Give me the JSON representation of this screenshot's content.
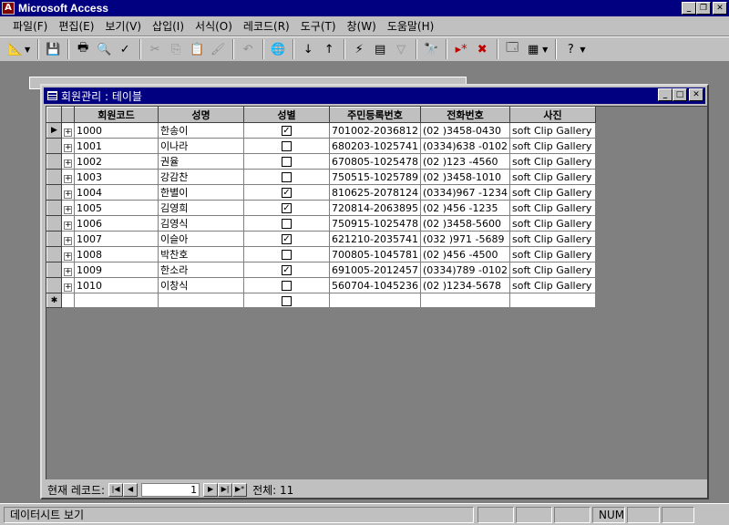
{
  "app": {
    "title": "Microsoft Access"
  },
  "menu": [
    "파일(F)",
    "편집(E)",
    "보기(V)",
    "삽입(I)",
    "서식(O)",
    "레코드(R)",
    "도구(T)",
    "창(W)",
    "도움말(H)"
  ],
  "toolbar": {
    "icons": [
      "design-view-icon",
      "save-icon",
      "print-icon",
      "print-preview-icon",
      "spelling-icon",
      "cut-icon",
      "copy-icon",
      "paste-icon",
      "format-painter-icon",
      "undo-icon",
      "hyperlink-icon",
      "sort-ascending-icon",
      "sort-descending-icon",
      "filter-by-selection-icon",
      "filter-by-form-icon",
      "apply-filter-icon",
      "find-icon",
      "new-record-icon",
      "delete-record-icon",
      "database-window-icon",
      "new-object-icon",
      "help-icon"
    ]
  },
  "datasheet": {
    "title": "회원관리 : 테이블",
    "columns": [
      "회원코드",
      "성명",
      "성별",
      "주민등록번호",
      "전화번호",
      "사진"
    ],
    "rows": [
      {
        "id": "1000",
        "name": "한송이",
        "gender": true,
        "jumin": "701002-2036812",
        "phone": "(02  )3458-0430",
        "photo": "soft Clip Gallery"
      },
      {
        "id": "1001",
        "name": "이나라",
        "gender": false,
        "jumin": "680203-1025741",
        "phone": "(0334)638  -0102",
        "photo": "soft Clip Gallery"
      },
      {
        "id": "1002",
        "name": "권율",
        "gender": false,
        "jumin": "670805-1025478",
        "phone": "(02  )123  -4560",
        "photo": "soft Clip Gallery"
      },
      {
        "id": "1003",
        "name": "강감찬",
        "gender": false,
        "jumin": "750515-1025789",
        "phone": "(02  )3458-1010",
        "photo": "soft Clip Gallery"
      },
      {
        "id": "1004",
        "name": "한별이",
        "gender": true,
        "jumin": "810625-2078124",
        "phone": "(0334)967  -1234",
        "photo": "soft Clip Gallery"
      },
      {
        "id": "1005",
        "name": "김영희",
        "gender": true,
        "jumin": "720814-2063895",
        "phone": "(02  )456  -1235",
        "photo": "soft Clip Gallery"
      },
      {
        "id": "1006",
        "name": "김영식",
        "gender": false,
        "jumin": "750915-1025478",
        "phone": "(02  )3458-5600",
        "photo": "soft Clip Gallery"
      },
      {
        "id": "1007",
        "name": "이슬아",
        "gender": true,
        "jumin": "621210-2035741",
        "phone": "(032 )971  -5689",
        "photo": "soft Clip Gallery"
      },
      {
        "id": "1008",
        "name": "박찬호",
        "gender": false,
        "jumin": "700805-1045781",
        "phone": "(02  )456  -4500",
        "photo": "soft Clip Gallery"
      },
      {
        "id": "1009",
        "name": "한소라",
        "gender": true,
        "jumin": "691005-2012457",
        "phone": "(0334)789  -0102",
        "photo": "soft Clip Gallery"
      },
      {
        "id": "1010",
        "name": "이창식",
        "gender": false,
        "jumin": "560704-1045236",
        "phone": "(02  )1234-5678",
        "photo": "soft Clip Gallery"
      }
    ]
  },
  "recnav": {
    "label": "현재 레코드:",
    "current": "1",
    "total_label": "전체: 11"
  },
  "status": {
    "text": "데이터시트 보기",
    "num": "NUM"
  }
}
